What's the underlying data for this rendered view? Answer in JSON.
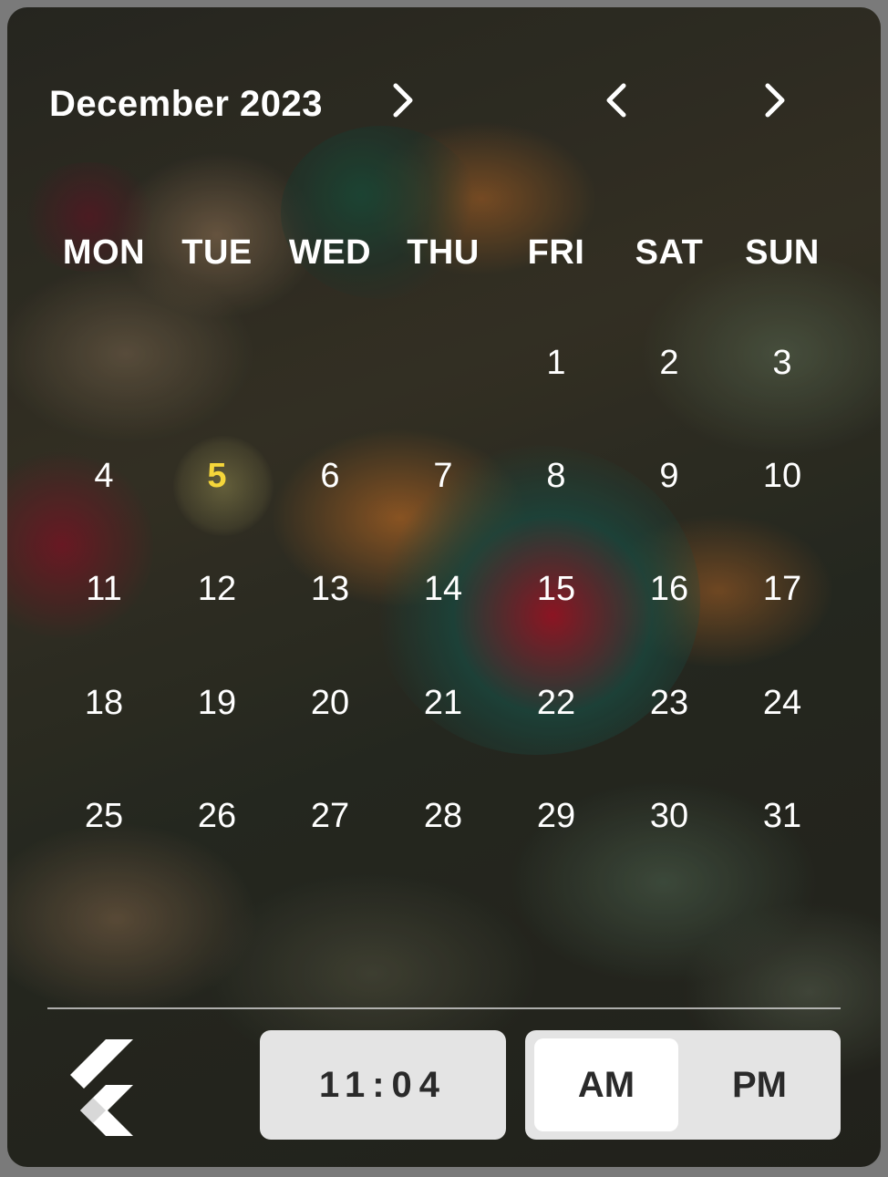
{
  "header": {
    "month_year": "December 2023"
  },
  "icons": {
    "month_dropdown": "chevron-right-icon",
    "prev": "chevron-left-icon",
    "next": "chevron-right-icon",
    "logo": "flutter-logo-icon"
  },
  "weekdays": [
    "MON",
    "TUE",
    "WED",
    "THU",
    "FRI",
    "SAT",
    "SUN"
  ],
  "days": {
    "row0": [
      "",
      "",
      "",
      "",
      "1",
      "2",
      "3"
    ],
    "row1": [
      "4",
      "5",
      "6",
      "7",
      "8",
      "9",
      "10"
    ],
    "row2": [
      "11",
      "12",
      "13",
      "14",
      "15",
      "16",
      "17"
    ],
    "row3": [
      "18",
      "19",
      "20",
      "21",
      "22",
      "23",
      "24"
    ],
    "row4": [
      "25",
      "26",
      "27",
      "28",
      "29",
      "30",
      "31"
    ]
  },
  "today": "5",
  "colors": {
    "today": "#f5d63a",
    "text": "#ffffff",
    "panel": "#e4e4e4"
  },
  "time": {
    "value": "11:04",
    "am_label": "AM",
    "pm_label": "PM",
    "selected": "AM"
  }
}
